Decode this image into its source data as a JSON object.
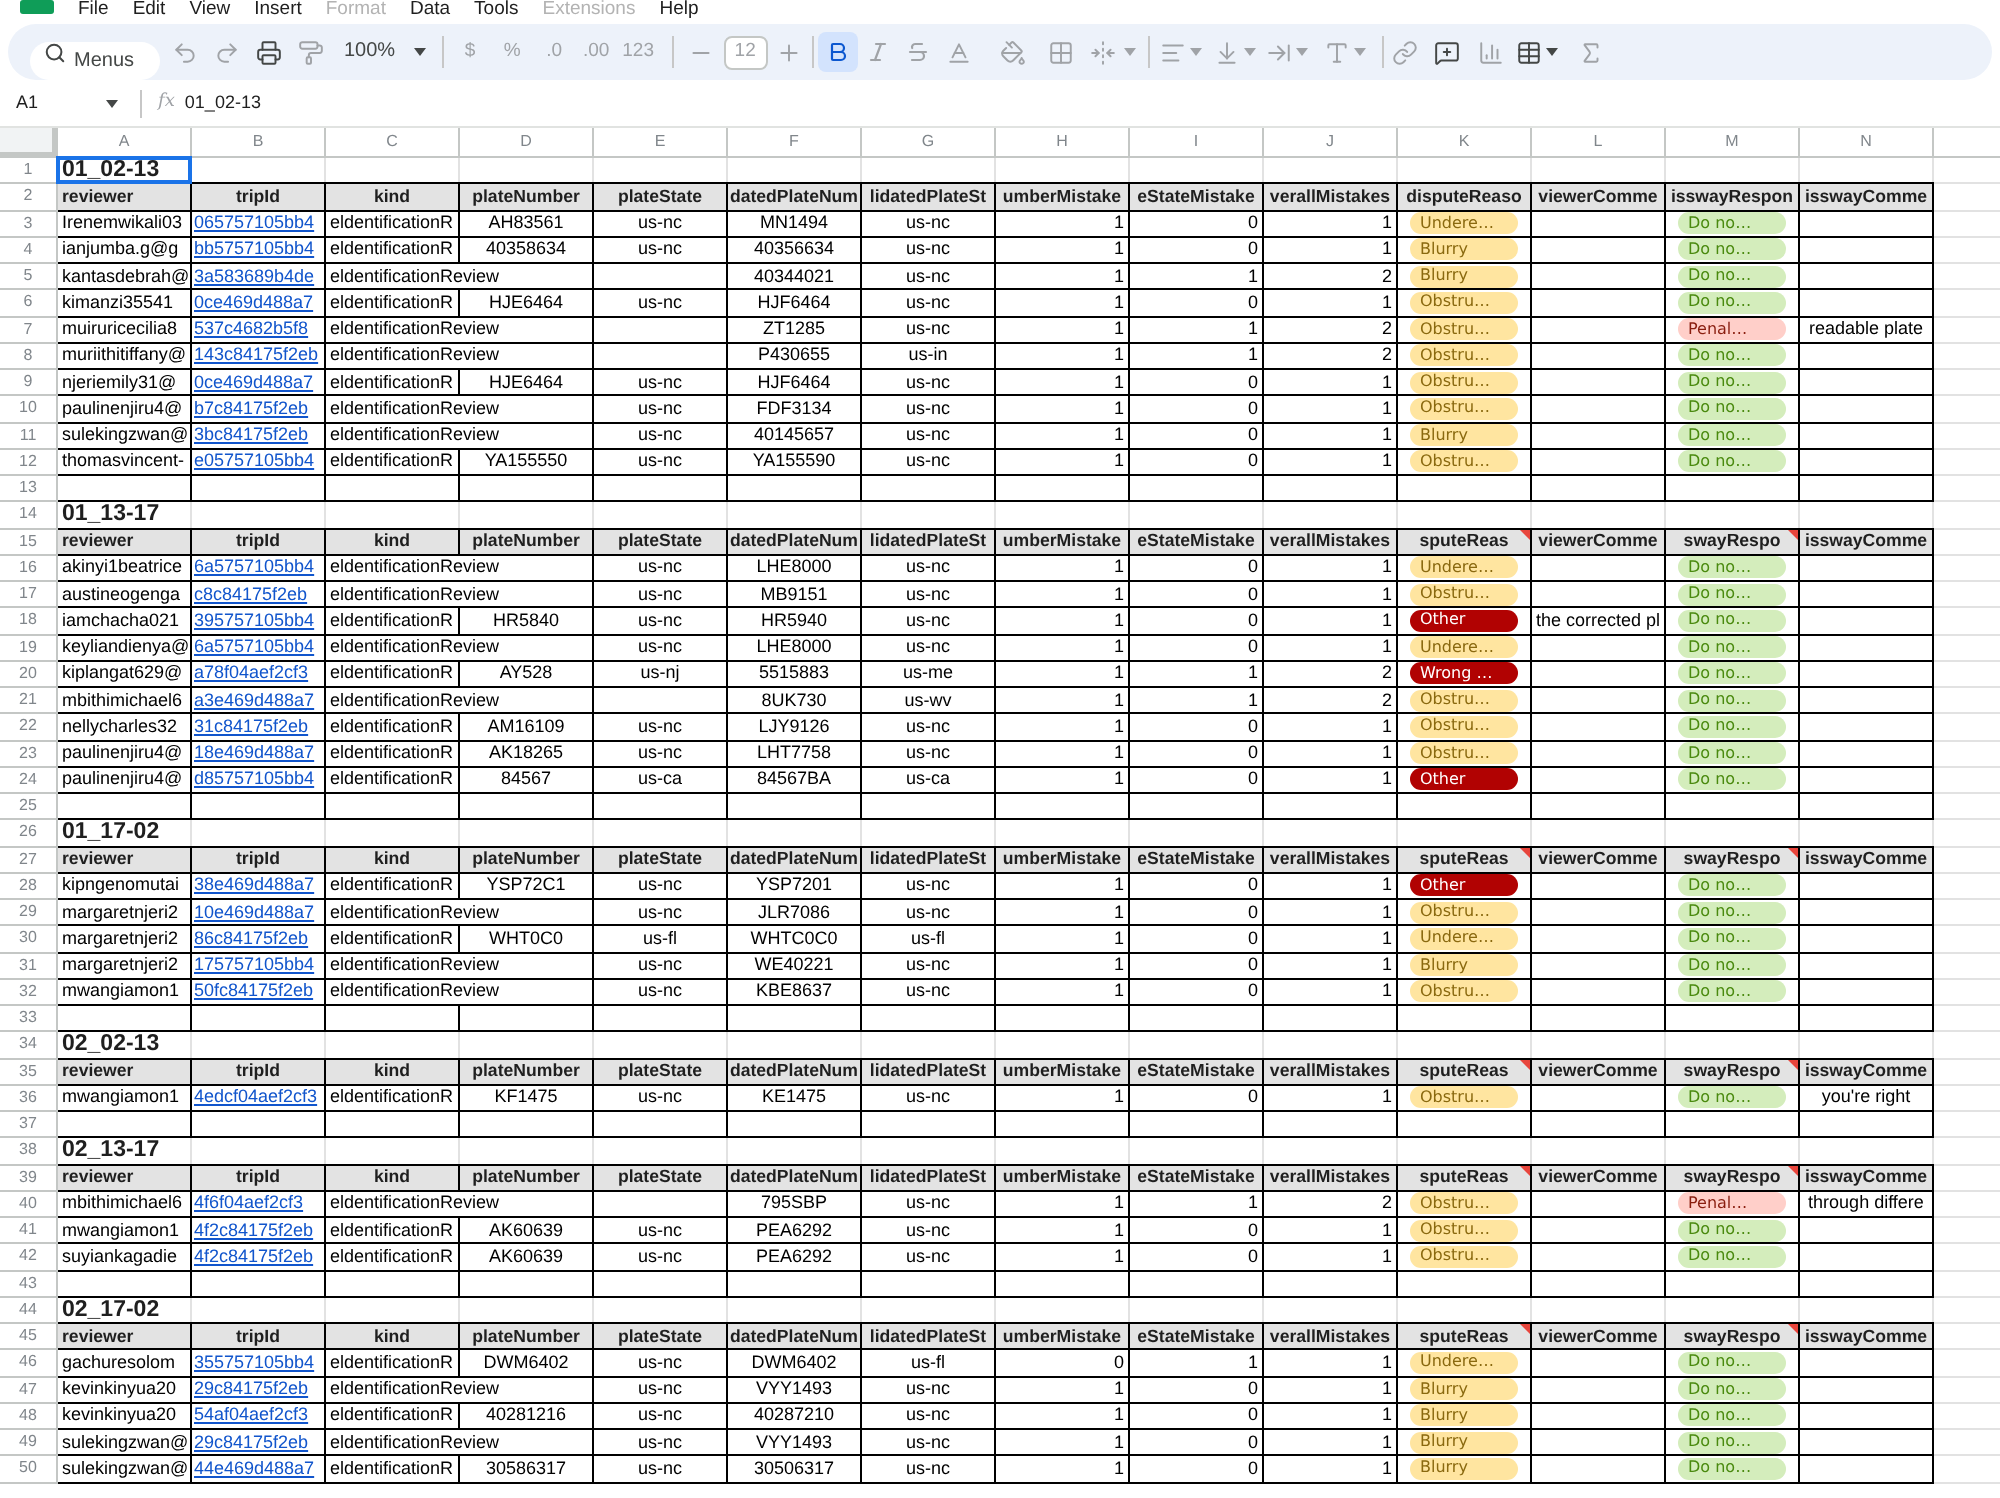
{
  "menu": [
    {
      "label": "File",
      "disabled": false
    },
    {
      "label": "Edit",
      "disabled": false
    },
    {
      "label": "View",
      "disabled": false
    },
    {
      "label": "Insert",
      "disabled": false
    },
    {
      "label": "Format",
      "disabled": true
    },
    {
      "label": "Data",
      "disabled": false
    },
    {
      "label": "Tools",
      "disabled": false
    },
    {
      "label": "Extensions",
      "disabled": true
    },
    {
      "label": "Help",
      "disabled": false
    }
  ],
  "toolbar": {
    "search": {
      "placeholder": "Menus"
    },
    "zoom": "100%",
    "number_formats": [
      {
        "label": "$",
        "disabled": true
      },
      {
        "label": "%",
        "disabled": true
      },
      {
        "label": ".0",
        "disabled": true
      },
      {
        "label": ".00",
        "disabled": true
      },
      {
        "label": "123",
        "disabled": true
      }
    ],
    "font_size": "12",
    "text_styles": [
      {
        "kind": "bold",
        "on": true
      },
      {
        "kind": "italic",
        "on": false
      },
      {
        "kind": "strikethrough",
        "on": false
      }
    ]
  },
  "formula_bar": {
    "cell_ref": "A1",
    "function_label": "fx",
    "content": "01_02-13"
  },
  "columns": [
    {
      "label": "A",
      "kind": "text",
      "selected": true
    },
    {
      "label": "B",
      "kind": "link",
      "selected": false
    },
    {
      "label": "C",
      "kind": "text",
      "selected": false
    },
    {
      "label": "D",
      "kind": "centered",
      "selected": false
    },
    {
      "label": "E",
      "kind": "centered",
      "selected": false
    },
    {
      "label": "F",
      "kind": "centered",
      "selected": false
    },
    {
      "label": "G",
      "kind": "centered",
      "selected": false
    },
    {
      "label": "H",
      "kind": "number",
      "selected": false
    },
    {
      "label": "I",
      "kind": "number",
      "selected": false
    },
    {
      "label": "J",
      "kind": "number",
      "selected": false
    },
    {
      "label": "K",
      "kind": "chip",
      "selected": false
    },
    {
      "label": "L",
      "kind": "text",
      "selected": false
    },
    {
      "label": "M",
      "kind": "chip",
      "selected": false
    },
    {
      "label": "N",
      "kind": "centered",
      "selected": false
    }
  ],
  "row_headers": [
    {
      "label": "1",
      "selected": true
    },
    {
      "label": "2",
      "selected": false
    },
    {
      "label": "3",
      "selected": false
    },
    {
      "label": "4",
      "selected": false
    },
    {
      "label": "5",
      "selected": false
    },
    {
      "label": "6",
      "selected": false
    },
    {
      "label": "7",
      "selected": false
    },
    {
      "label": "8",
      "selected": false
    },
    {
      "label": "9",
      "selected": false
    },
    {
      "label": "10",
      "selected": false
    },
    {
      "label": "11",
      "selected": false
    },
    {
      "label": "12",
      "selected": false
    },
    {
      "label": "13",
      "selected": false
    },
    {
      "label": "14",
      "selected": false
    },
    {
      "label": "15",
      "selected": false
    },
    {
      "label": "16",
      "selected": false
    },
    {
      "label": "17",
      "selected": false
    },
    {
      "label": "18",
      "selected": false
    },
    {
      "label": "19",
      "selected": false
    },
    {
      "label": "20",
      "selected": false
    },
    {
      "label": "21",
      "selected": false
    },
    {
      "label": "22",
      "selected": false
    },
    {
      "label": "23",
      "selected": false
    },
    {
      "label": "24",
      "selected": false
    },
    {
      "label": "25",
      "selected": false
    },
    {
      "label": "26",
      "selected": false
    },
    {
      "label": "27",
      "selected": false
    },
    {
      "label": "28",
      "selected": false
    },
    {
      "label": "29",
      "selected": false
    },
    {
      "label": "30",
      "selected": false
    },
    {
      "label": "31",
      "selected": false
    },
    {
      "label": "32",
      "selected": false
    },
    {
      "label": "33",
      "selected": false
    },
    {
      "label": "34",
      "selected": false
    },
    {
      "label": "35",
      "selected": false
    },
    {
      "label": "36",
      "selected": false
    },
    {
      "label": "37",
      "selected": false
    },
    {
      "label": "38",
      "selected": false
    },
    {
      "label": "39",
      "selected": false
    },
    {
      "label": "40",
      "selected": false
    },
    {
      "label": "41",
      "selected": false
    },
    {
      "label": "42",
      "selected": false
    },
    {
      "label": "43",
      "selected": false
    },
    {
      "label": "44",
      "selected": false
    },
    {
      "label": "45",
      "selected": false
    },
    {
      "label": "46",
      "selected": false
    },
    {
      "label": "47",
      "selected": false
    },
    {
      "label": "48",
      "selected": false
    },
    {
      "label": "49",
      "selected": false
    },
    {
      "label": "50",
      "selected": false
    }
  ],
  "sections": [
    {
      "title": "01_02-13",
      "headers": [
        {
          "label": "reviewer",
          "note": false
        },
        {
          "label": "tripId",
          "note": false
        },
        {
          "label": "kind",
          "note": false
        },
        {
          "label": "plateNumber",
          "note": false
        },
        {
          "label": "plateState",
          "note": false
        },
        {
          "label": "datedPlateNum",
          "note": false
        },
        {
          "label": "lidatedPlateSt",
          "note": false
        },
        {
          "label": "umberMistake",
          "note": false
        },
        {
          "label": "eStateMistake",
          "note": false
        },
        {
          "label": "verallMistakes",
          "note": false
        },
        {
          "label": "disputeReaso",
          "note": false
        },
        {
          "label": "viewerComme",
          "note": false
        },
        {
          "label": "isswayRespon",
          "note": false
        },
        {
          "label": "isswayComme",
          "note": false
        }
      ],
      "rows": [
        {
          "A": "Irenemwikali03",
          "B": "065757105bb4",
          "C": "eldentificationR",
          "D": "AH83561",
          "E": "us-nc",
          "F": "MN1494",
          "G": "us-nc",
          "H": "1",
          "I": "0",
          "J": "1",
          "K": {
            "label": "Undere…",
            "color": "#ffe5a0"
          },
          "M": {
            "label": "Do no…",
            "color": "#d4edbc"
          }
        },
        {
          "A": "ianjumba.g@g",
          "B": "bb5757105bb4",
          "C": "eldentificationR",
          "D": "40358634",
          "E": "us-nc",
          "F": "40356634",
          "G": "us-nc",
          "H": "1",
          "I": "0",
          "J": "1",
          "K": {
            "label": "Blurry",
            "color": "#ffe5a0"
          },
          "M": {
            "label": "Do no…",
            "color": "#d4edbc"
          }
        },
        {
          "A": "kantasdebrah@",
          "B": "3a583689b4de",
          "C": "eldentificationReview",
          "F": "40344021",
          "G": "us-nc",
          "H": "1",
          "I": "1",
          "J": "2",
          "K": {
            "label": "Blurry",
            "color": "#ffe5a0"
          },
          "M": {
            "label": "Do no…",
            "color": "#d4edbc"
          }
        },
        {
          "A": "kimanzi35541",
          "B": "0ce469d488a7",
          "C": "eldentificationR",
          "D": "HJE6464",
          "E": "us-nc",
          "F": "HJF6464",
          "G": "us-nc",
          "H": "1",
          "I": "0",
          "J": "1",
          "K": {
            "label": "Obstru…",
            "color": "#ffe5a0"
          },
          "M": {
            "label": "Do no…",
            "color": "#d4edbc"
          }
        },
        {
          "A": "muiruricecilia8",
          "B": "537c4682b5f8",
          "C": "eldentificationReview",
          "F": "ZT1285",
          "G": "us-nc",
          "H": "1",
          "I": "1",
          "J": "2",
          "K": {
            "label": "Obstru…",
            "color": "#ffe5a0"
          },
          "M": {
            "label": "Penal…",
            "color": "#ffcfc9"
          },
          "N": "readable plate"
        },
        {
          "A": "muriithitiffany@",
          "B": "143c84175f2eb",
          "C": "eldentificationReview",
          "F": "P430655",
          "G": "us-in",
          "H": "1",
          "I": "1",
          "J": "2",
          "K": {
            "label": "Obstru…",
            "color": "#ffe5a0"
          },
          "M": {
            "label": "Do no…",
            "color": "#d4edbc"
          }
        },
        {
          "A": "njeriemily31@",
          "B": "0ce469d488a7",
          "C": "eldentificationR",
          "D": "HJE6464",
          "E": "us-nc",
          "F": "HJF6464",
          "G": "us-nc",
          "H": "1",
          "I": "0",
          "J": "1",
          "K": {
            "label": "Obstru…",
            "color": "#ffe5a0"
          },
          "M": {
            "label": "Do no…",
            "color": "#d4edbc"
          }
        },
        {
          "A": "paulinenjiru4@",
          "B": "b7c84175f2eb",
          "C": "eldentificationReview",
          "E": "us-nc",
          "F": "FDF3134",
          "G": "us-nc",
          "H": "1",
          "I": "0",
          "J": "1",
          "K": {
            "label": "Obstru…",
            "color": "#ffe5a0"
          },
          "M": {
            "label": "Do no…",
            "color": "#d4edbc"
          }
        },
        {
          "A": "sulekingzwan@",
          "B": "3bc84175f2eb",
          "C": "eldentificationReview",
          "E": "us-nc",
          "F": "40145657",
          "G": "us-nc",
          "H": "1",
          "I": "0",
          "J": "1",
          "K": {
            "label": "Blurry",
            "color": "#ffe5a0"
          },
          "M": {
            "label": "Do no…",
            "color": "#d4edbc"
          }
        },
        {
          "A": "thomasvincent-",
          "B": "e05757105bb4",
          "C": "eldentificationR",
          "D": "YA155550",
          "E": "us-nc",
          "F": "YA155590",
          "G": "us-nc",
          "H": "1",
          "I": "0",
          "J": "1",
          "K": {
            "label": "Obstru…",
            "color": "#ffe5a0"
          },
          "M": {
            "label": "Do no…",
            "color": "#d4edbc"
          }
        }
      ]
    },
    {
      "title": "01_13-17",
      "headers": [
        {
          "label": "reviewer",
          "note": false
        },
        {
          "label": "tripId",
          "note": false
        },
        {
          "label": "kind",
          "note": false
        },
        {
          "label": "plateNumber",
          "note": false
        },
        {
          "label": "plateState",
          "note": false
        },
        {
          "label": "datedPlateNum",
          "note": false
        },
        {
          "label": "lidatedPlateSt",
          "note": false
        },
        {
          "label": "umberMistake",
          "note": false
        },
        {
          "label": "eStateMistake",
          "note": false
        },
        {
          "label": "verallMistakes",
          "note": false
        },
        {
          "label": "sputeReas",
          "note": true
        },
        {
          "label": "viewerComme",
          "note": false
        },
        {
          "label": "swayRespo",
          "note": true
        },
        {
          "label": "isswayComme",
          "note": false
        }
      ],
      "rows": [
        {
          "A": "akinyi1beatrice",
          "B": "6a5757105bb4",
          "C": "eldentificationReview",
          "E": "us-nc",
          "F": "LHE8000",
          "G": "us-nc",
          "H": "1",
          "I": "0",
          "J": "1",
          "K": {
            "label": "Undere…",
            "color": "#ffe5a0"
          },
          "M": {
            "label": "Do no…",
            "color": "#d4edbc"
          }
        },
        {
          "A": "austineogenga",
          "B": "c8c84175f2eb",
          "C": "eldentificationReview",
          "E": "us-nc",
          "F": "MB9151",
          "G": "us-nc",
          "H": "1",
          "I": "0",
          "J": "1",
          "K": {
            "label": "Obstru…",
            "color": "#ffe5a0"
          },
          "M": {
            "label": "Do no…",
            "color": "#d4edbc"
          }
        },
        {
          "A": "iamchacha021",
          "B": "395757105bb4",
          "C": "eldentificationR",
          "D": "HR5840",
          "E": "us-nc",
          "F": "HR5940",
          "G": "us-nc",
          "H": "1",
          "I": "0",
          "J": "1",
          "K": {
            "label": "Other",
            "color": "#b10202"
          },
          "L": "the corrected pl",
          "M": {
            "label": "Do no…",
            "color": "#d4edbc"
          }
        },
        {
          "A": "keyliandienya@",
          "B": "6a5757105bb4",
          "C": "eldentificationReview",
          "E": "us-nc",
          "F": "LHE8000",
          "G": "us-nc",
          "H": "1",
          "I": "0",
          "J": "1",
          "K": {
            "label": "Undere…",
            "color": "#ffe5a0"
          },
          "M": {
            "label": "Do no…",
            "color": "#d4edbc"
          }
        },
        {
          "A": "kiplangat629@",
          "B": "a78f04aef2cf3",
          "C": "eldentificationR",
          "D": "AY528",
          "E": "us-nj",
          "F": "5515883",
          "G": "us-me",
          "H": "1",
          "I": "1",
          "J": "2",
          "K": {
            "label": "Wrong …",
            "color": "#b10202"
          },
          "M": {
            "label": "Do no…",
            "color": "#d4edbc"
          }
        },
        {
          "A": "mbithimichael6",
          "B": "a3e469d488a7",
          "C": "eldentificationReview",
          "F": "8UK730",
          "G": "us-wv",
          "H": "1",
          "I": "1",
          "J": "2",
          "K": {
            "label": "Obstru…",
            "color": "#ffe5a0"
          },
          "M": {
            "label": "Do no…",
            "color": "#d4edbc"
          }
        },
        {
          "A": "nellycharles32",
          "B": "31c84175f2eb",
          "C": "eldentificationR",
          "D": "AM16109",
          "E": "us-nc",
          "F": "LJY9126",
          "G": "us-nc",
          "H": "1",
          "I": "0",
          "J": "1",
          "K": {
            "label": "Obstru…",
            "color": "#ffe5a0"
          },
          "M": {
            "label": "Do no…",
            "color": "#d4edbc"
          }
        },
        {
          "A": "paulinenjiru4@",
          "B": "18e469d488a7",
          "C": "eldentificationR",
          "D": "AK18265",
          "E": "us-nc",
          "F": "LHT7758",
          "G": "us-nc",
          "H": "1",
          "I": "0",
          "J": "1",
          "K": {
            "label": "Obstru…",
            "color": "#ffe5a0"
          },
          "M": {
            "label": "Do no…",
            "color": "#d4edbc"
          }
        },
        {
          "A": "paulinenjiru4@",
          "B": "d85757105bb4",
          "C": "eldentificationR",
          "D": "84567",
          "E": "us-ca",
          "F": "84567BA",
          "G": "us-ca",
          "H": "1",
          "I": "0",
          "J": "1",
          "K": {
            "label": "Other",
            "color": "#b10202"
          },
          "M": {
            "label": "Do no…",
            "color": "#d4edbc"
          }
        }
      ]
    },
    {
      "title": "01_17-02",
      "headers": [
        {
          "label": "reviewer",
          "note": false
        },
        {
          "label": "tripId",
          "note": false
        },
        {
          "label": "kind",
          "note": false
        },
        {
          "label": "plateNumber",
          "note": false
        },
        {
          "label": "plateState",
          "note": false
        },
        {
          "label": "datedPlateNum",
          "note": false
        },
        {
          "label": "lidatedPlateSt",
          "note": false
        },
        {
          "label": "umberMistake",
          "note": false
        },
        {
          "label": "eStateMistake",
          "note": false
        },
        {
          "label": "verallMistakes",
          "note": false
        },
        {
          "label": "sputeReas",
          "note": true
        },
        {
          "label": "viewerComme",
          "note": false
        },
        {
          "label": "swayRespo",
          "note": true
        },
        {
          "label": "isswayComme",
          "note": false
        }
      ],
      "rows": [
        {
          "A": "kipngenomutai",
          "B": "38e469d488a7",
          "C": "eldentificationR",
          "D": "YSP72C1",
          "E": "us-nc",
          "F": "YSP7201",
          "G": "us-nc",
          "H": "1",
          "I": "0",
          "J": "1",
          "K": {
            "label": "Other",
            "color": "#b10202"
          },
          "M": {
            "label": "Do no…",
            "color": "#d4edbc"
          }
        },
        {
          "A": "margaretnjeri2",
          "B": "10e469d488a7",
          "C": "eldentificationReview",
          "E": "us-nc",
          "F": "JLR7086",
          "G": "us-nc",
          "H": "1",
          "I": "0",
          "J": "1",
          "K": {
            "label": "Obstru…",
            "color": "#ffe5a0"
          },
          "M": {
            "label": "Do no…",
            "color": "#d4edbc"
          }
        },
        {
          "A": "margaretnjeri2",
          "B": "86c84175f2eb",
          "C": "eldentificationR",
          "D": "WHT0C0",
          "E": "us-fl",
          "F": "WHTC0C0",
          "G": "us-fl",
          "H": "1",
          "I": "0",
          "J": "1",
          "K": {
            "label": "Undere…",
            "color": "#ffe5a0"
          },
          "M": {
            "label": "Do no…",
            "color": "#d4edbc"
          }
        },
        {
          "A": "margaretnjeri2",
          "B": "175757105bb4",
          "C": "eldentificationReview",
          "E": "us-nc",
          "F": "WE40221",
          "G": "us-nc",
          "H": "1",
          "I": "0",
          "J": "1",
          "K": {
            "label": "Blurry",
            "color": "#ffe5a0"
          },
          "M": {
            "label": "Do no…",
            "color": "#d4edbc"
          }
        },
        {
          "A": "mwangiamon1",
          "B": "50fc84175f2eb",
          "C": "eldentificationReview",
          "E": "us-nc",
          "F": "KBE8637",
          "G": "us-nc",
          "H": "1",
          "I": "0",
          "J": "1",
          "K": {
            "label": "Obstru…",
            "color": "#ffe5a0"
          },
          "M": {
            "label": "Do no…",
            "color": "#d4edbc"
          }
        }
      ]
    },
    {
      "title": "02_02-13",
      "headers": [
        {
          "label": "reviewer",
          "note": false
        },
        {
          "label": "tripId",
          "note": false
        },
        {
          "label": "kind",
          "note": false
        },
        {
          "label": "plateNumber",
          "note": false
        },
        {
          "label": "plateState",
          "note": false
        },
        {
          "label": "datedPlateNum",
          "note": false
        },
        {
          "label": "lidatedPlateSt",
          "note": false
        },
        {
          "label": "umberMistake",
          "note": false
        },
        {
          "label": "eStateMistake",
          "note": false
        },
        {
          "label": "verallMistakes",
          "note": false
        },
        {
          "label": "sputeReas",
          "note": true
        },
        {
          "label": "viewerComme",
          "note": false
        },
        {
          "label": "swayRespo",
          "note": true
        },
        {
          "label": "isswayComme",
          "note": false
        }
      ],
      "rows": [
        {
          "A": "mwangiamon1",
          "B": "4edcf04aef2cf3",
          "C": "eldentificationR",
          "D": "KF1475",
          "E": "us-nc",
          "F": "KE1475",
          "G": "us-nc",
          "H": "1",
          "I": "0",
          "J": "1",
          "K": {
            "label": "Obstru…",
            "color": "#ffe5a0"
          },
          "M": {
            "label": "Do no…",
            "color": "#d4edbc"
          },
          "N": "you're right"
        }
      ]
    },
    {
      "title": "02_13-17",
      "headers": [
        {
          "label": "reviewer",
          "note": false
        },
        {
          "label": "tripId",
          "note": false
        },
        {
          "label": "kind",
          "note": false
        },
        {
          "label": "plateNumber",
          "note": false
        },
        {
          "label": "plateState",
          "note": false
        },
        {
          "label": "datedPlateNum",
          "note": false
        },
        {
          "label": "lidatedPlateSt",
          "note": false
        },
        {
          "label": "umberMistake",
          "note": false
        },
        {
          "label": "eStateMistake",
          "note": false
        },
        {
          "label": "verallMistakes",
          "note": false
        },
        {
          "label": "sputeReas",
          "note": true
        },
        {
          "label": "viewerComme",
          "note": false
        },
        {
          "label": "swayRespo",
          "note": true
        },
        {
          "label": "isswayComme",
          "note": false
        }
      ],
      "rows": [
        {
          "A": "mbithimichael6",
          "B": "4f6f04aef2cf3",
          "C": "eldentificationReview",
          "F": "795SBP",
          "G": "us-nc",
          "H": "1",
          "I": "1",
          "J": "2",
          "K": {
            "label": "Obstru…",
            "color": "#ffe5a0"
          },
          "M": {
            "label": "Penal…",
            "color": "#ffcfc9"
          },
          "N": "through differe"
        },
        {
          "A": "mwangiamon1",
          "B": "4f2c84175f2eb",
          "C": "eldentificationR",
          "D": "AK60639",
          "E": "us-nc",
          "F": "PEA6292",
          "G": "us-nc",
          "H": "1",
          "I": "0",
          "J": "1",
          "K": {
            "label": "Obstru…",
            "color": "#ffe5a0"
          },
          "M": {
            "label": "Do no…",
            "color": "#d4edbc"
          }
        },
        {
          "A": "suyiankagadie",
          "B": "4f2c84175f2eb",
          "C": "eldentificationR",
          "D": "AK60639",
          "E": "us-nc",
          "F": "PEA6292",
          "G": "us-nc",
          "H": "1",
          "I": "0",
          "J": "1",
          "K": {
            "label": "Obstru…",
            "color": "#ffe5a0"
          },
          "M": {
            "label": "Do no…",
            "color": "#d4edbc"
          }
        }
      ]
    },
    {
      "title": "02_17-02",
      "headers": [
        {
          "label": "reviewer",
          "note": false
        },
        {
          "label": "tripId",
          "note": false
        },
        {
          "label": "kind",
          "note": false
        },
        {
          "label": "plateNumber",
          "note": false
        },
        {
          "label": "plateState",
          "note": false
        },
        {
          "label": "datedPlateNum",
          "note": false
        },
        {
          "label": "lidatedPlateSt",
          "note": false
        },
        {
          "label": "umberMistake",
          "note": false
        },
        {
          "label": "eStateMistake",
          "note": false
        },
        {
          "label": "verallMistakes",
          "note": false
        },
        {
          "label": "sputeReas",
          "note": true
        },
        {
          "label": "viewerComme",
          "note": false
        },
        {
          "label": "swayRespo",
          "note": true
        },
        {
          "label": "isswayComme",
          "note": false
        }
      ],
      "rows": [
        {
          "A": "gachuresolom",
          "B": "355757105bb4",
          "C": "eldentificationR",
          "D": "DWM6402",
          "E": "us-nc",
          "F": "DWM6402",
          "G": "us-fl",
          "H": "0",
          "I": "1",
          "J": "1",
          "K": {
            "label": "Undere…",
            "color": "#ffe5a0"
          },
          "M": {
            "label": "Do no…",
            "color": "#d4edbc"
          }
        },
        {
          "A": "kevinkinyua20",
          "B": "29c84175f2eb",
          "C": "eldentificationReview",
          "E": "us-nc",
          "F": "VYY1493",
          "G": "us-nc",
          "H": "1",
          "I": "0",
          "J": "1",
          "K": {
            "label": "Blurry",
            "color": "#ffe5a0"
          },
          "M": {
            "label": "Do no…",
            "color": "#d4edbc"
          }
        },
        {
          "A": "kevinkinyua20",
          "B": "54af04aef2cf3",
          "C": "eldentificationR",
          "D": "40281216",
          "E": "us-nc",
          "F": "40287210",
          "G": "us-nc",
          "H": "1",
          "I": "0",
          "J": "1",
          "K": {
            "label": "Blurry",
            "color": "#ffe5a0"
          },
          "M": {
            "label": "Do no…",
            "color": "#d4edbc"
          }
        },
        {
          "A": "sulekingzwan@",
          "B": "29c84175f2eb",
          "C": "eldentificationReview",
          "E": "us-nc",
          "F": "VYY1493",
          "G": "us-nc",
          "H": "1",
          "I": "0",
          "J": "1",
          "K": {
            "label": "Blurry",
            "color": "#ffe5a0"
          },
          "M": {
            "label": "Do no…",
            "color": "#d4edbc"
          }
        },
        {
          "A": "sulekingzwan@",
          "B": "44e469d488a7",
          "C": "eldentificationR",
          "D": "30586317",
          "E": "us-nc",
          "F": "30506317",
          "G": "us-nc",
          "H": "1",
          "I": "0",
          "J": "1",
          "K": {
            "label": "Blurry",
            "color": "#ffe5a0"
          },
          "M": {
            "label": "Do no…",
            "color": "#d4edbc"
          }
        }
      ]
    }
  ]
}
